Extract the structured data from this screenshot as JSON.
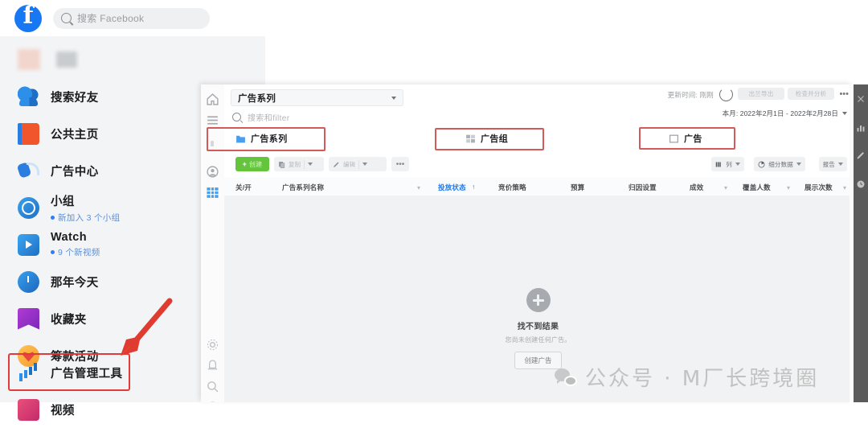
{
  "facebook": {
    "search": {
      "placeholder": "搜索 Facebook",
      "icon": "search-icon"
    },
    "logo_letter": "f",
    "sidebar_items": [
      {
        "label": "搜索好友",
        "icon": "friends-icon",
        "sub": ""
      },
      {
        "label": "公共主页",
        "icon": "page-flag-icon",
        "sub": ""
      },
      {
        "label": "广告中心",
        "icon": "megaphone-icon",
        "sub": ""
      },
      {
        "label": "小组",
        "icon": "group-icon",
        "sub": "新加入 3 个小组"
      },
      {
        "label": "Watch",
        "icon": "watch-video-icon",
        "sub": "9 个新视频"
      },
      {
        "label": "那年今天",
        "icon": "memories-clock-icon",
        "sub": ""
      },
      {
        "label": "收藏夹",
        "icon": "bookmark-icon",
        "sub": ""
      },
      {
        "label": "筹款活动",
        "icon": "fundraiser-heart-icon",
        "sub": ""
      },
      {
        "label": "广告管理工具",
        "icon": "ads-manager-bars-icon",
        "sub": ""
      },
      {
        "label": "视频",
        "icon": "video-icon",
        "sub": ""
      }
    ]
  },
  "panel": {
    "account_select": {
      "value": "广告系列",
      "icon": "chevron-down-icon"
    },
    "search": {
      "placeholder": "搜索和filter",
      "icon": "search-icon"
    },
    "updated_label": "更新时间: 刚刚",
    "refresh_icon": "refresh-icon",
    "ghost_buttons": [
      {
        "label": "出兰导出"
      },
      {
        "label": "检查并分析"
      }
    ],
    "more_icon": "ellipsis-icon",
    "date_range": {
      "label": "本月: 2022年2月1日 - 2022年2月28日",
      "icon": "chevron-down-icon"
    },
    "tabs": [
      {
        "label": "广告系列",
        "icon": "campaign-folder-icon",
        "highlighted": true
      },
      {
        "label": "广告组",
        "icon": "adset-icon",
        "highlighted": true
      },
      {
        "label": "广告",
        "icon": "ad-icon",
        "highlighted": true
      }
    ],
    "toolbar": {
      "create_label": "创建",
      "create_plus": "+",
      "duplicate_label": "复制",
      "edit_label": "编辑",
      "more_dots": "•••",
      "columns_label": "列",
      "breakdown_label": "细分数据",
      "reports_label": "报告"
    },
    "table_headers": [
      "关/开",
      "广告系列名称",
      "投放状态",
      "竞价策略",
      "预算",
      "归因设置",
      "成效",
      "覆盖人数",
      "展示次数"
    ],
    "empty_state": {
      "title": "找不到结果",
      "subtitle": "您尚未创建任何广告。",
      "button": "创建广告",
      "icon": "plus-circle-icon"
    }
  },
  "dark_rail": {
    "icons": [
      "close-icon",
      "chart-icon",
      "pencil-icon",
      "clock-icon"
    ]
  },
  "watermark": {
    "text": "公众号 · M厂长跨境圈",
    "icon": "wechat-icon"
  },
  "annotations": {
    "arrow_color": "#e03b30",
    "box_color": "#d45a5a",
    "arrow_target": "广告管理工具"
  }
}
